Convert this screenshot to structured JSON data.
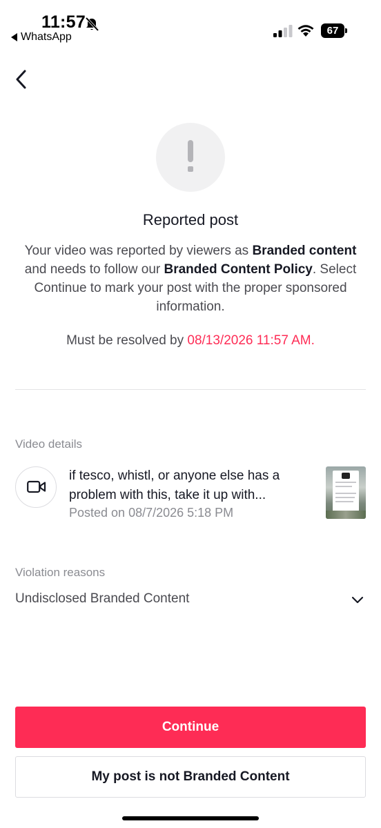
{
  "status_bar": {
    "time": "11:57",
    "back_app": "WhatsApp",
    "battery": "67"
  },
  "header": {
    "title": "Reported post",
    "desc_parts": [
      "Your video was reported by viewers as ",
      "Branded content",
      " and needs to follow our ",
      "Branded Content Policy",
      ". Select Continue to mark your post with the proper sponsored information."
    ],
    "deadline_label": "Must be resolved by ",
    "deadline_value": "08/13/2026 11:57 AM."
  },
  "video_details": {
    "label": "Video details",
    "title": "if tesco, whistl, or anyone else has a problem with this, take it up with...",
    "posted": "Posted on 08/7/2026 5:18 PM"
  },
  "violation": {
    "label": "Violation reasons",
    "value": "Undisclosed Branded Content"
  },
  "buttons": {
    "continue": "Continue",
    "not_branded": "My post is not Branded Content"
  },
  "colors": {
    "accent": "#fe2c55",
    "text_primary": "#161823",
    "text_secondary": "#8a8b91"
  },
  "icons": {
    "back": "chevron-left-icon",
    "alert": "exclamation-icon",
    "video": "video-camera-icon",
    "dropdown": "chevron-down-icon"
  }
}
